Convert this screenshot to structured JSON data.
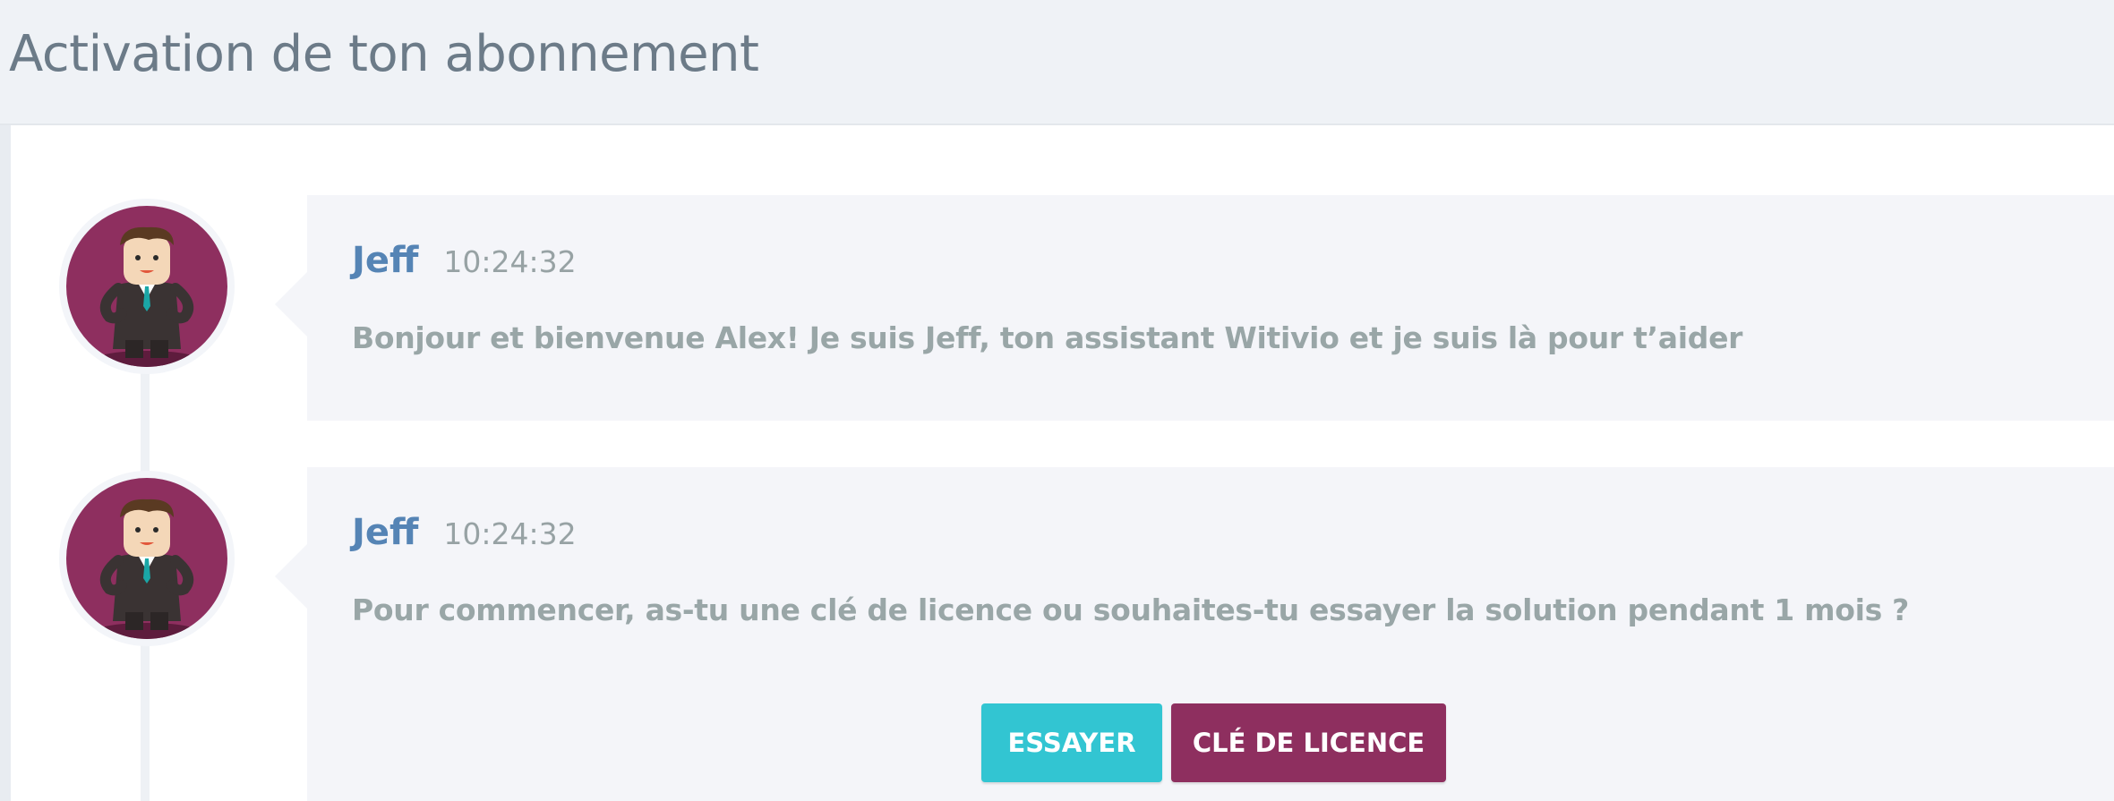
{
  "page": {
    "title": "Activation de ton abonnement"
  },
  "colors": {
    "header_bg": "#eff2f6",
    "bubble_bg": "#f4f5f9",
    "author": "#5584b5",
    "accent_try": "#32c5d2",
    "accent_license": "#8e2f5f",
    "avatar_bg": "#8e2f5f"
  },
  "messages": [
    {
      "author": "Jeff",
      "time": "10:24:32",
      "text": "Bonjour et bienvenue Alex! Je suis Jeff, ton assistant Witivio et je suis là pour t’aider",
      "avatar_icon": "assistant-avatar-icon"
    },
    {
      "author": "Jeff",
      "time": "10:24:32",
      "text": "Pour commencer, as-tu une clé de licence ou souhaites-tu essayer la solution pendant 1 mois ?",
      "avatar_icon": "assistant-avatar-icon",
      "actions": [
        {
          "label": "ESSAYER"
        },
        {
          "label": "CLÉ DE LICENCE"
        }
      ]
    }
  ]
}
